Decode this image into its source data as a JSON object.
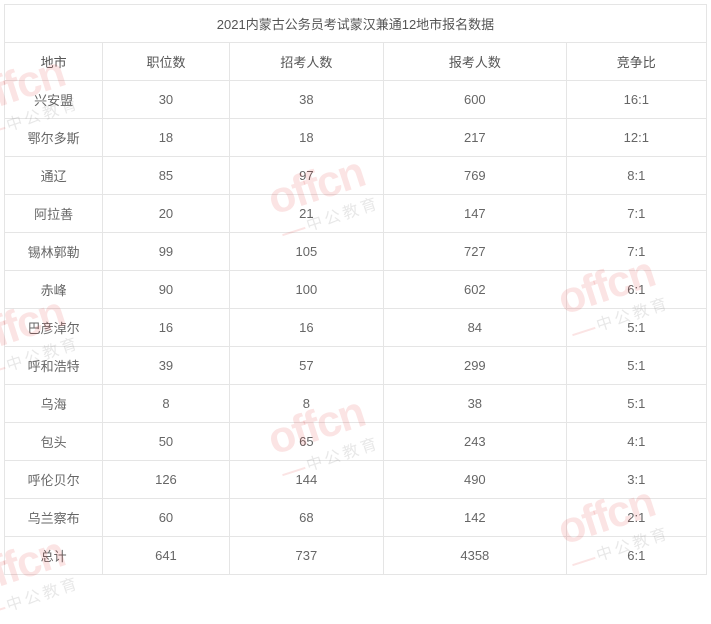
{
  "title": "2021内蒙古公务员考试蒙汉兼通12地市报名数据",
  "headers": [
    "地市",
    "职位数",
    "招考人数",
    "报考人数",
    "竞争比"
  ],
  "rows": [
    [
      "兴安盟",
      "30",
      "38",
      "600",
      "16:1"
    ],
    [
      "鄂尔多斯",
      "18",
      "18",
      "217",
      "12:1"
    ],
    [
      "通辽",
      "85",
      "97",
      "769",
      "8:1"
    ],
    [
      "阿拉善",
      "20",
      "21",
      "147",
      "7:1"
    ],
    [
      "锡林郭勒",
      "99",
      "105",
      "727",
      "7:1"
    ],
    [
      "赤峰",
      "90",
      "100",
      "602",
      "6:1"
    ],
    [
      "巴彦淖尔",
      "16",
      "16",
      "84",
      "5:1"
    ],
    [
      "呼和浩特",
      "39",
      "57",
      "299",
      "5:1"
    ],
    [
      "乌海",
      "8",
      "8",
      "38",
      "5:1"
    ],
    [
      "包头",
      "50",
      "65",
      "243",
      "4:1"
    ],
    [
      "呼伦贝尔",
      "126",
      "144",
      "490",
      "3:1"
    ],
    [
      "乌兰察布",
      "60",
      "68",
      "142",
      "2:1"
    ],
    [
      "总计",
      "641",
      "737",
      "4358",
      "6:1"
    ]
  ],
  "watermark": {
    "main": "offcn",
    "sub": "中公教育"
  }
}
